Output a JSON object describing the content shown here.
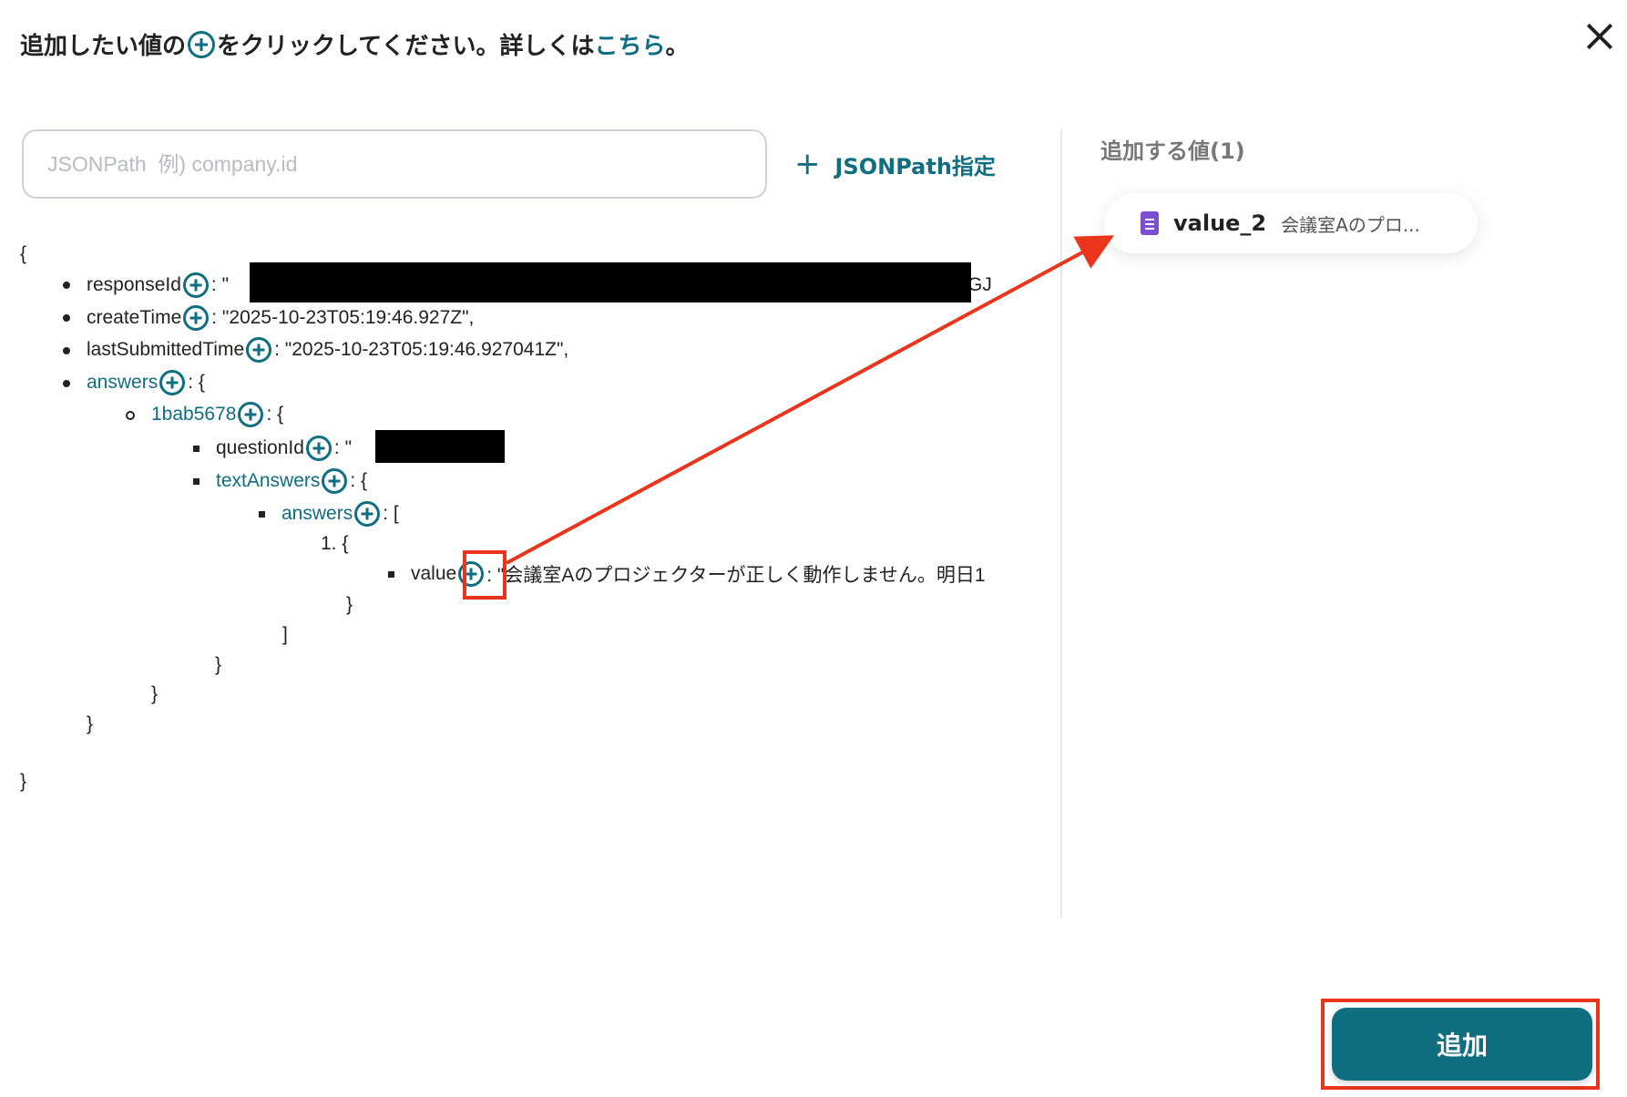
{
  "header": {
    "title_before": "追加したい値の",
    "title_after": "をクリックしてください。詳しくは",
    "link": "こちら",
    "title_end": "。"
  },
  "search": {
    "placeholder": "JSONPath  例) company.id",
    "jsonpath_button": "JSONPath指定"
  },
  "tree": {
    "open_brace": "{",
    "close_brace": "}",
    "lines": {
      "responseId_key": "responseId",
      "responseId_val": ": \"",
      "responseId_tail": "GJ",
      "createTime_key": "createTime",
      "createTime_val": ": \"2025-10-23T05:19:46.927Z\",",
      "lastSubmittedTime_key": "lastSubmittedTime",
      "lastSubmittedTime_val": ": \"2025-10-23T05:19:46.927041Z\",",
      "answers_key": "answers",
      "answers_val": ": {",
      "item_key": "1bab5678",
      "item_val": ": {",
      "questionId_key": "questionId",
      "questionId_val": ": \"",
      "textAnswers_key": "textAnswers",
      "textAnswers_val": ": {",
      "inner_answers_key": "answers",
      "inner_answers_val": ": [",
      "list_start": "1. {",
      "value_key": "value",
      "value_val": ": \"会議室Aのプロジェクターが正しく動作しません。明日1",
      "close_1": "}",
      "close_2": "]",
      "close_3": "}",
      "close_4": "}",
      "close_5": "}"
    }
  },
  "right_panel": {
    "label": "追加する値(1)",
    "chip": {
      "icon": "google-forms-icon",
      "name": "value_2",
      "preview": "会議室Aのプロ..."
    }
  },
  "footer": {
    "add_button": "追加"
  },
  "colors": {
    "accent": "#0f6e80",
    "highlight": "#e8351c",
    "forms_purple": "#7b4fd0"
  }
}
